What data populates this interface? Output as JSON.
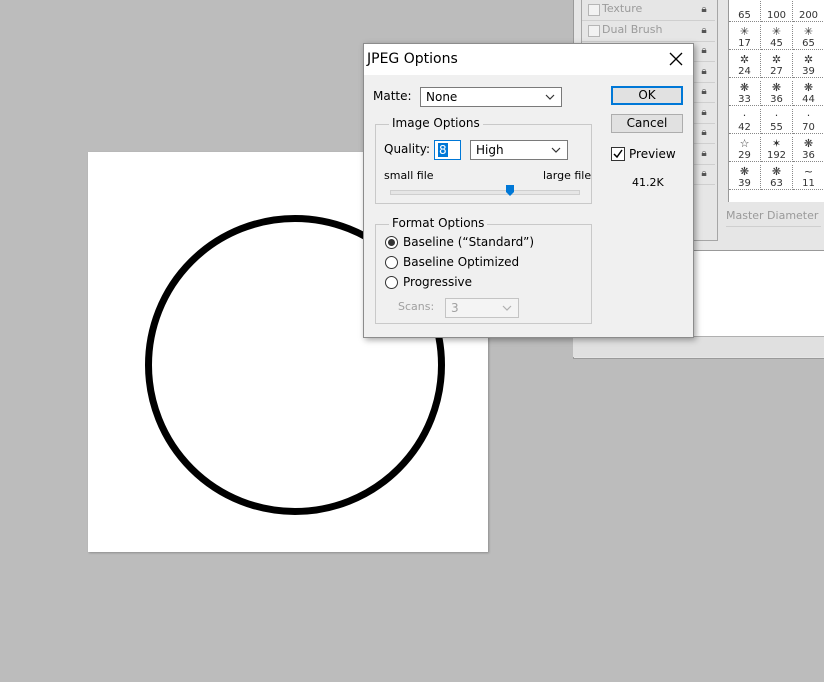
{
  "dialog": {
    "title": "JPEG Options",
    "matte_label": "Matte:",
    "matte_value": "None",
    "image_options": {
      "legend": "Image Options",
      "quality_label": "Quality:",
      "quality_value": "8",
      "quality_preset": "High",
      "small_file_label": "small file",
      "large_file_label": "large file",
      "quality_slider_fraction": 0.64
    },
    "format_options": {
      "legend": "Format Options",
      "options": [
        "Baseline (“Standard”)",
        "Baseline Optimized",
        "Progressive"
      ],
      "selected_index": 0,
      "scans_label": "Scans:",
      "scans_value": "3"
    },
    "ok_label": "OK",
    "cancel_label": "Cancel",
    "preview_label": "Preview",
    "preview_checked": true,
    "file_size": "41.2K"
  },
  "brush_panel": {
    "items": [
      {
        "label": "Texture"
      },
      {
        "label": "Dual Brush"
      },
      {
        "label": ""
      },
      {
        "label": ""
      },
      {
        "label": ""
      },
      {
        "label": ""
      },
      {
        "label": ""
      },
      {
        "label": ""
      },
      {
        "label": ""
      }
    ],
    "presets": [
      {
        "glyph": "",
        "size": "65"
      },
      {
        "glyph": "",
        "size": "100"
      },
      {
        "glyph": "",
        "size": "200"
      },
      {
        "glyph": "✳",
        "size": "17"
      },
      {
        "glyph": "✳",
        "size": "45"
      },
      {
        "glyph": "✳",
        "size": "65"
      },
      {
        "glyph": "✲",
        "size": "24"
      },
      {
        "glyph": "✲",
        "size": "27"
      },
      {
        "glyph": "✲",
        "size": "39"
      },
      {
        "glyph": "❋",
        "size": "33"
      },
      {
        "glyph": "❋",
        "size": "36"
      },
      {
        "glyph": "❋",
        "size": "44"
      },
      {
        "glyph": "·",
        "size": "42"
      },
      {
        "glyph": "·",
        "size": "55"
      },
      {
        "glyph": "·",
        "size": "70"
      },
      {
        "glyph": "☆",
        "size": "29"
      },
      {
        "glyph": "✶",
        "size": "192"
      },
      {
        "glyph": "❋",
        "size": "36"
      },
      {
        "glyph": "❋",
        "size": "39"
      },
      {
        "glyph": "❋",
        "size": "63"
      },
      {
        "glyph": "~",
        "size": "11"
      }
    ],
    "master_diameter_label": "Master Diameter"
  }
}
